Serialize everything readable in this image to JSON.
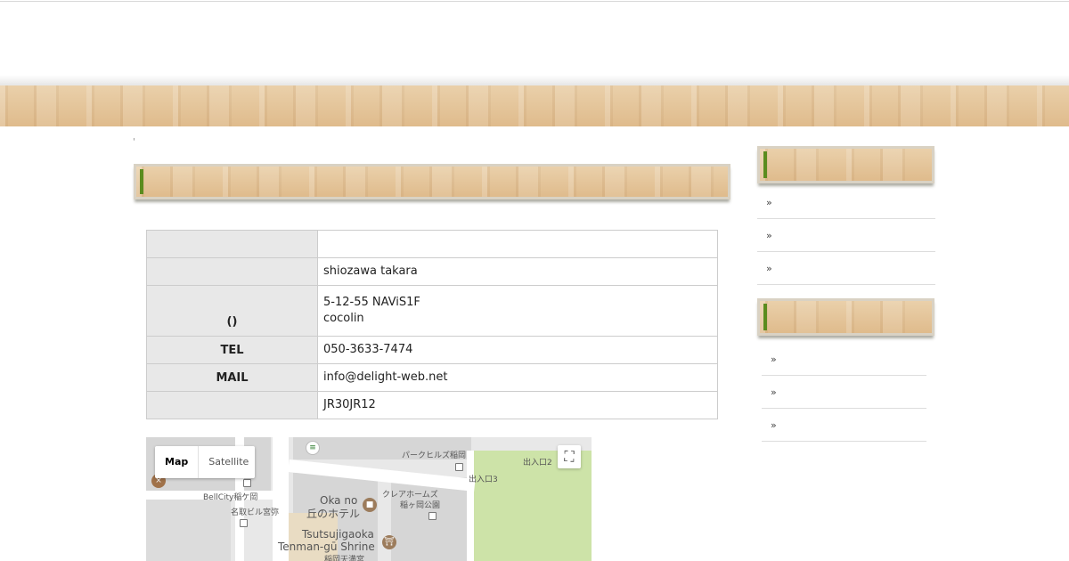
{
  "breadcrumb": "'",
  "info_table": [
    {
      "label": "",
      "lines": [
        ""
      ]
    },
    {
      "label": "",
      "lines": [
        " shiozawa takara"
      ]
    },
    {
      "label": "()",
      "lines": [
        "5-12-55 NAViS1F",
        "cocolin"
      ]
    },
    {
      "label": "TEL",
      "lines": [
        "050-3633-7474"
      ]
    },
    {
      "label": "MAIL",
      "lines": [
        "info@delight-web.net"
      ]
    },
    {
      "label": "",
      "lines": [
        "JR30JR12"
      ]
    }
  ],
  "map": {
    "map_label": "Map",
    "satellite_label": "Satellite",
    "fullscreen_icon": "fullscreen-icon",
    "places": {
      "park_hills": "パークヒルズ稲岡",
      "exit2": "出入口2",
      "exit3": "出入口3",
      "bellcity": "BellCity稲ケ岡",
      "meitori": "名取ビル宮弥",
      "okano_hotel_1": "Oka no",
      "okano_hotel_2": "丘のホテル",
      "clear_homes_1": "クレアホームズ",
      "clear_homes_2": "稲ヶ岡公園",
      "shrine_1": "Tsutsujigaoka",
      "shrine_2": "Tenman-gū Shrine",
      "shrine_3": "稲岡天満宮"
    }
  },
  "sidebar": {
    "group1": [
      "»",
      "»",
      "»"
    ],
    "group2": [
      "»",
      "»",
      "»"
    ]
  },
  "colors": {
    "accent_green": "#5b8c1e",
    "header_cell": "#e8e8e8",
    "wood": "#e7c79e"
  }
}
